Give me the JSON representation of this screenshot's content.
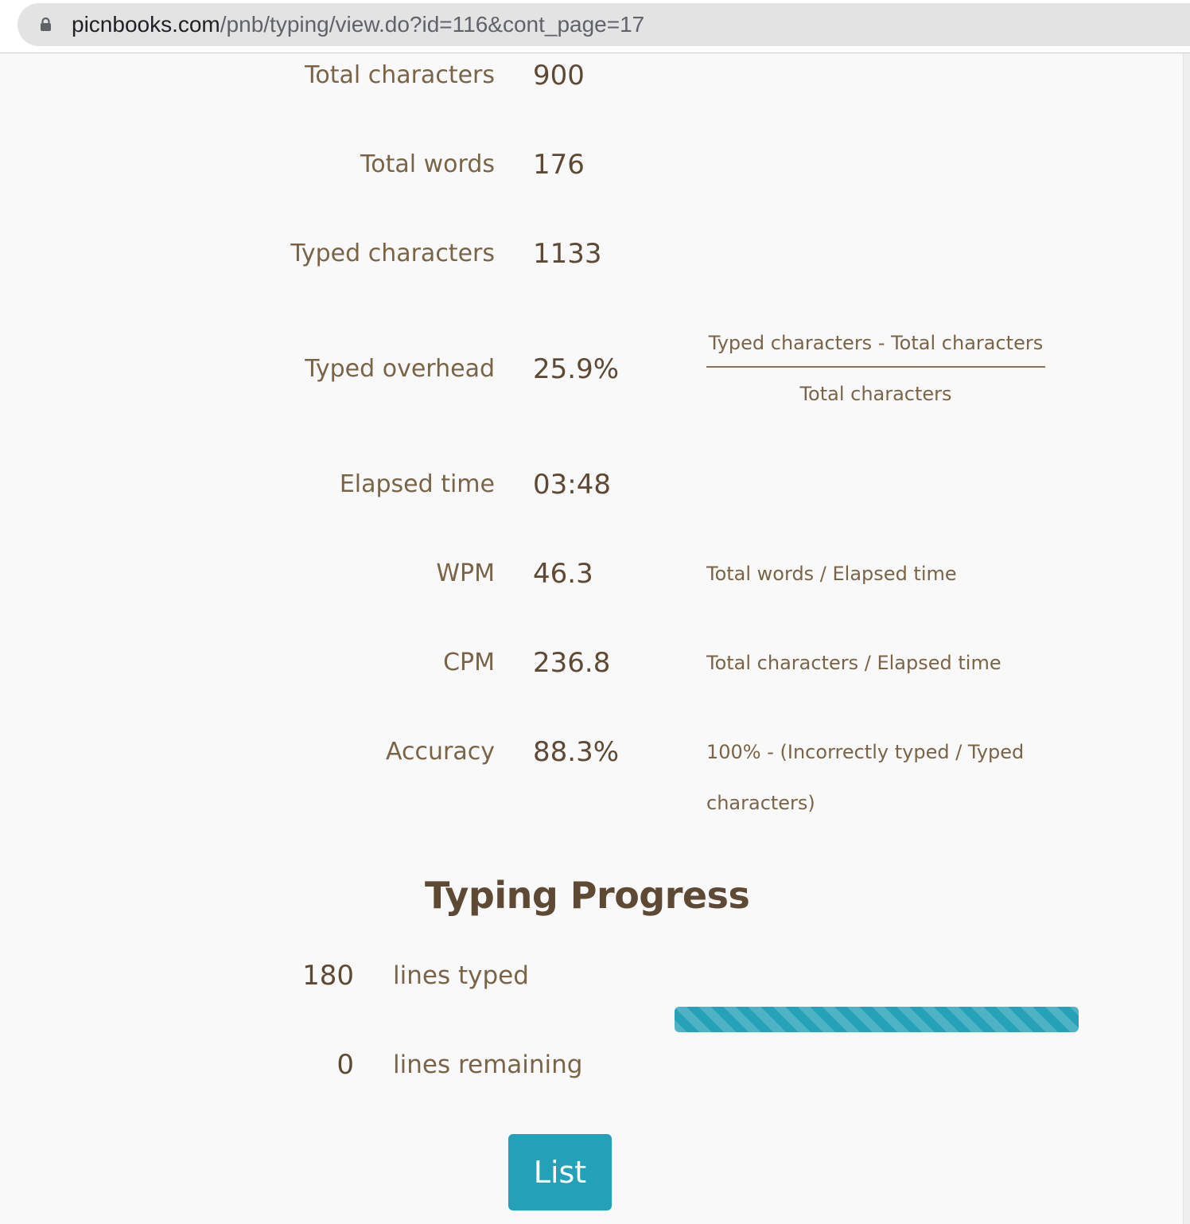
{
  "browser": {
    "url_host": "picnbooks.com",
    "url_path": "/pnb/typing/view.do?id=116&cont_page=17"
  },
  "stats": {
    "total_characters": {
      "label": "Total characters",
      "value": "900"
    },
    "total_words": {
      "label": "Total words",
      "value": "176"
    },
    "typed_characters": {
      "label": "Typed characters",
      "value": "1133"
    },
    "typed_overhead": {
      "label": "Typed overhead",
      "value": "25.9%",
      "formula_numerator": "Typed characters - Total characters",
      "formula_denominator": "Total characters"
    },
    "elapsed_time": {
      "label": "Elapsed time",
      "value": "03:48"
    },
    "wpm": {
      "label": "WPM",
      "value": "46.3",
      "formula": "Total words / Elapsed time"
    },
    "cpm": {
      "label": "CPM",
      "value": "236.8",
      "formula": "Total characters / Elapsed time"
    },
    "accuracy": {
      "label": "Accuracy",
      "value": "88.3%",
      "formula": "100% - (Incorrectly typed / Typed characters)"
    }
  },
  "progress": {
    "title": "Typing Progress",
    "typed_count": "180",
    "typed_label": "lines typed",
    "remaining_count": "0",
    "remaining_label": "lines remaining",
    "completion_fraction": 1.0,
    "bar_color": "#26a2b8"
  },
  "actions": {
    "list_label": "List",
    "accent_color": "#22a1b8"
  },
  "icons": {
    "lock": "lock-icon"
  }
}
